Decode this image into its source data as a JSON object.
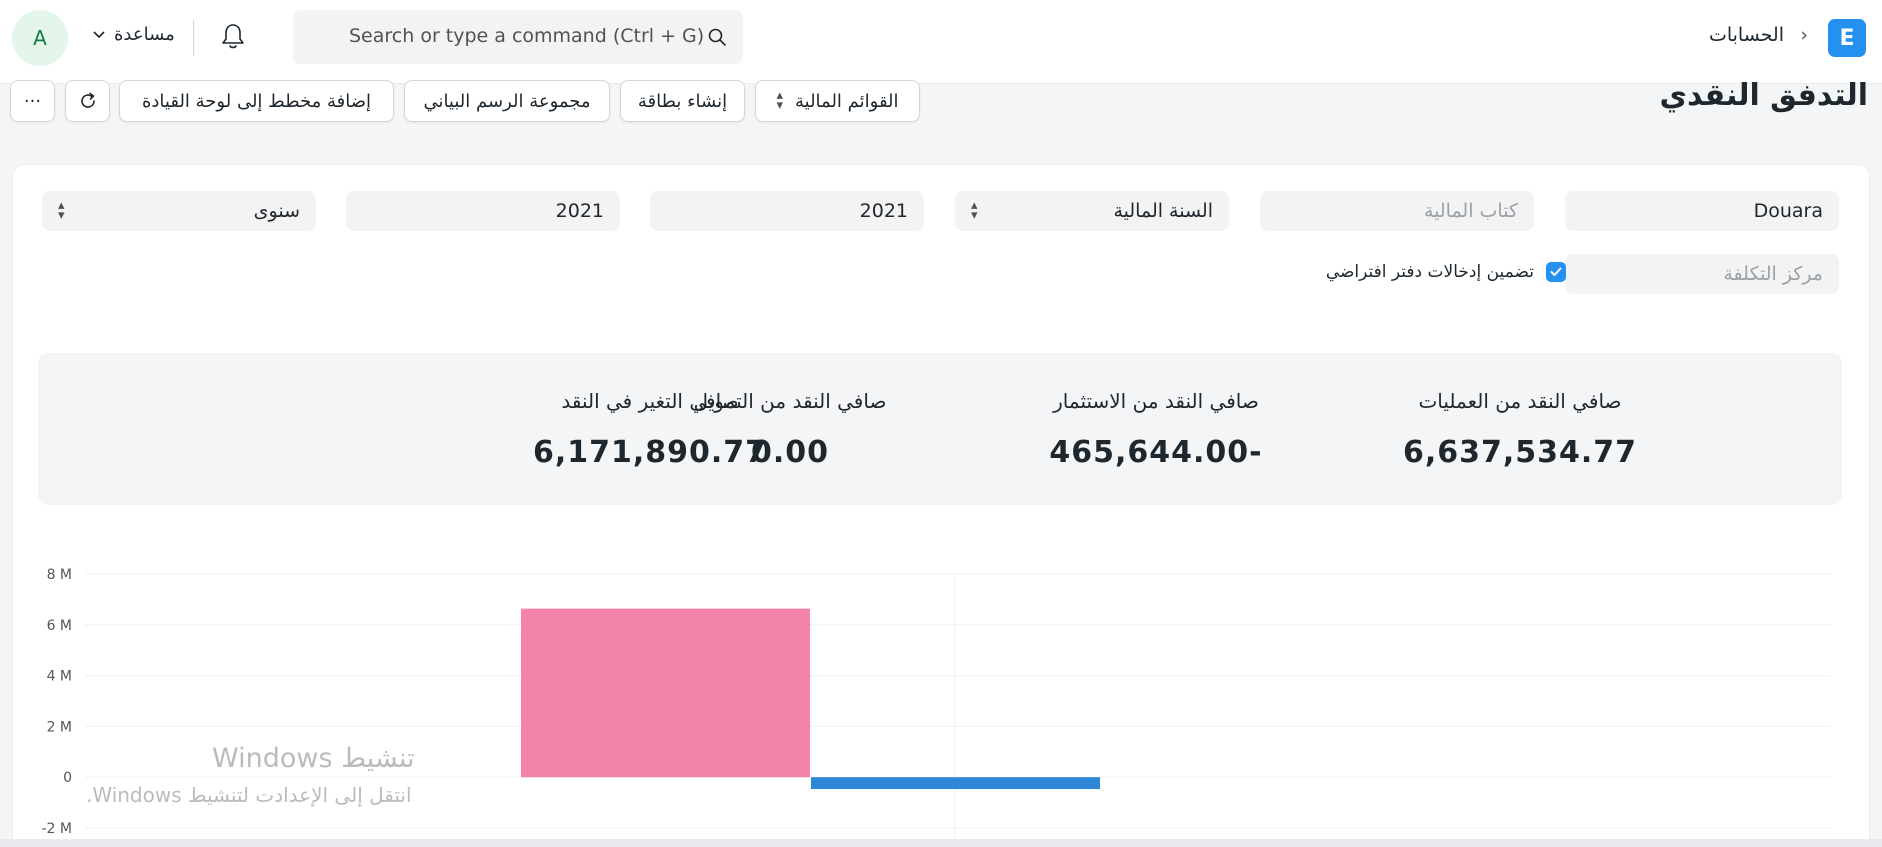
{
  "navbar": {
    "logo_letter": "E",
    "breadcrumb": "الحسابات",
    "breadcrumb_sep": "›",
    "search_placeholder": "Search or type a command (Ctrl + G)",
    "help_label": "مساعدة",
    "avatar_letter": "A"
  },
  "page": {
    "title": "التدفق النقدي",
    "buttons": {
      "financial_statements": "القوائم المالية",
      "create_card": "إنشاء بطاقة",
      "chart_group": "مجموعة الرسم البياني",
      "add_to_dashboard": "إضافة مخطط إلى لوحة القيادة",
      "more": "···"
    }
  },
  "filters": {
    "company": "Douara",
    "finance_book_placeholder": "كتاب المالية",
    "filter_based_on": "السنة المالية",
    "from_year": "2021",
    "to_year": "2021",
    "periodicity": "سنوى",
    "cost_center_placeholder": "مركز التكلفة",
    "include_default_book": "تضمين إدخالات دفتر افتراضي"
  },
  "summary": [
    {
      "label": "صافي النقد من العمليات",
      "value": "6,637,534.77"
    },
    {
      "label": "صافي النقد من الاستثمار",
      "value": "-465,644.00"
    },
    {
      "label": "صافي النقد من التمويل",
      "value": "0.00"
    },
    {
      "label": "صافي التغير في النقد",
      "value": "6,171,890.77"
    }
  ],
  "colors": {
    "primary": "#2490ef",
    "bar_operations": "#f483ab",
    "bar_investing": "#2e86d8"
  },
  "chart_data": {
    "type": "bar",
    "y_ticks": [
      "8 M",
      "6 M",
      "4 M",
      "2 M",
      "0",
      "-2 M"
    ],
    "ylim": [
      -2000000,
      8000000
    ],
    "series": [
      {
        "values": [
          6637534.77
        ]
      },
      {
        "values": [
          -465644.0
        ]
      }
    ],
    "grid": true
  },
  "watermark": {
    "title": "تنشيط Windows",
    "subtitle": "انتقل إلى الإعدادت لتنشيط Windows."
  }
}
